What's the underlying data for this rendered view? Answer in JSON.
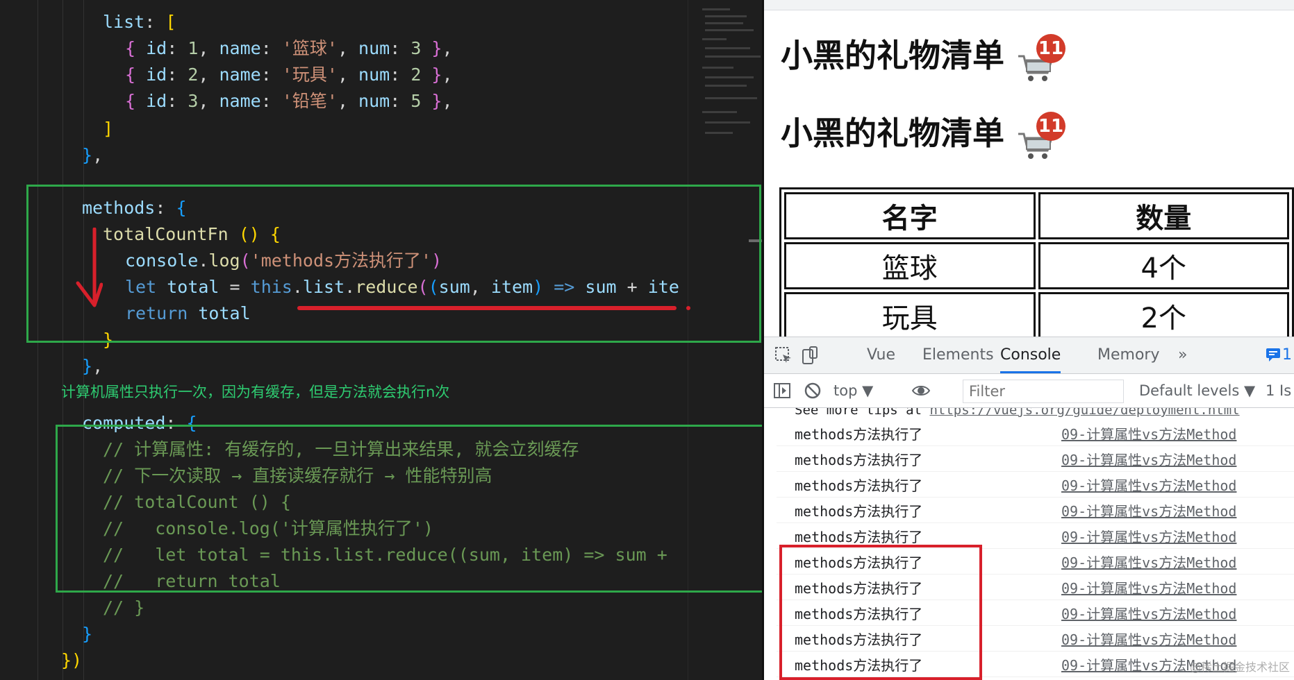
{
  "editor": {
    "lines": [
      [
        [
          "k",
          "list"
        ],
        [
          "p",
          ": "
        ],
        [
          "b1",
          "["
        ]
      ],
      [
        [
          "b2",
          "{ "
        ],
        [
          "k",
          "id"
        ],
        [
          "p",
          ": "
        ],
        [
          "n",
          "1"
        ],
        [
          "p",
          ", "
        ],
        [
          "k",
          "name"
        ],
        [
          "p",
          ": "
        ],
        [
          "s",
          "'篮球'"
        ],
        [
          "p",
          ", "
        ],
        [
          "k",
          "num"
        ],
        [
          "p",
          ": "
        ],
        [
          "n",
          "3"
        ],
        [
          "b2",
          " }"
        ],
        [
          "p",
          ","
        ]
      ],
      [
        [
          "b2",
          "{ "
        ],
        [
          "k",
          "id"
        ],
        [
          "p",
          ": "
        ],
        [
          "n",
          "2"
        ],
        [
          "p",
          ", "
        ],
        [
          "k",
          "name"
        ],
        [
          "p",
          ": "
        ],
        [
          "s",
          "'玩具'"
        ],
        [
          "p",
          ", "
        ],
        [
          "k",
          "num"
        ],
        [
          "p",
          ": "
        ],
        [
          "n",
          "2"
        ],
        [
          "b2",
          " }"
        ],
        [
          "p",
          ","
        ]
      ],
      [
        [
          "b2",
          "{ "
        ],
        [
          "k",
          "id"
        ],
        [
          "p",
          ": "
        ],
        [
          "n",
          "3"
        ],
        [
          "p",
          ", "
        ],
        [
          "k",
          "name"
        ],
        [
          "p",
          ": "
        ],
        [
          "s",
          "'铅笔'"
        ],
        [
          "p",
          ", "
        ],
        [
          "k",
          "num"
        ],
        [
          "p",
          ": "
        ],
        [
          "n",
          "5"
        ],
        [
          "b2",
          " }"
        ],
        [
          "p",
          ","
        ]
      ],
      [
        [
          "b1",
          "]"
        ]
      ],
      [
        [
          "b3",
          "}"
        ],
        [
          "p",
          ","
        ]
      ],
      [],
      [
        [
          "k",
          "methods"
        ],
        [
          "p",
          ": "
        ],
        [
          "b3",
          "{"
        ]
      ],
      [
        [
          "f",
          "totalCountFn"
        ],
        [
          "p",
          " "
        ],
        [
          "b1",
          "()"
        ],
        [
          "p",
          " "
        ],
        [
          "b1",
          "{"
        ]
      ],
      [
        [
          "k",
          "console"
        ],
        [
          "p",
          "."
        ],
        [
          "f",
          "log"
        ],
        [
          "b2",
          "("
        ],
        [
          "s",
          "'methods方法执行了'"
        ],
        [
          "b2",
          ")"
        ]
      ],
      [
        [
          "kw",
          "let"
        ],
        [
          "p",
          " "
        ],
        [
          "k",
          "total"
        ],
        [
          "p",
          " = "
        ],
        [
          "kw",
          "this"
        ],
        [
          "p",
          "."
        ],
        [
          "k",
          "list"
        ],
        [
          "p",
          "."
        ],
        [
          "f",
          "reduce"
        ],
        [
          "b2",
          "("
        ],
        [
          "b3",
          "("
        ],
        [
          "k",
          "sum"
        ],
        [
          "p",
          ", "
        ],
        [
          "k",
          "item"
        ],
        [
          "b3",
          ")"
        ],
        [
          "p",
          " "
        ],
        [
          "kw",
          "=>"
        ],
        [
          "p",
          " "
        ],
        [
          "k",
          "sum"
        ],
        [
          "p",
          " + "
        ],
        [
          "k",
          "ite"
        ]
      ],
      [
        [
          "kw",
          "return"
        ],
        [
          "p",
          " "
        ],
        [
          "k",
          "total"
        ]
      ],
      [
        [
          "b1",
          "}"
        ]
      ],
      [
        [
          "b3",
          "}"
        ],
        [
          "p",
          ","
        ]
      ],
      [],
      [
        [
          "k",
          "computed"
        ],
        [
          "p",
          ": "
        ],
        [
          "b3",
          "{"
        ]
      ],
      [
        [
          "c",
          "// 计算属性: 有缓存的, 一旦计算出来结果, 就会立刻缓存"
        ]
      ],
      [
        [
          "c",
          "// 下一次读取 → 直接读缓存就行 → 性能特别高"
        ]
      ],
      [
        [
          "c",
          "// totalCount () {"
        ]
      ],
      [
        [
          "c",
          "//   console.log('计算属性执行了')"
        ]
      ],
      [
        [
          "c",
          "//   let total = this.list.reduce((sum, item) => sum +"
        ]
      ],
      [
        [
          "c",
          "//   return total"
        ]
      ],
      [
        [
          "c",
          "// }"
        ]
      ],
      [
        [
          "b3",
          "}"
        ]
      ],
      [
        [
          "b1",
          "})"
        ]
      ]
    ],
    "annotation": "计算机属性只执行一次，因为有缓存，但是方法就会执行n次"
  },
  "browser": {
    "page_title": "小黑的礼物清单",
    "badge_count": "11",
    "table": {
      "headers": [
        "名字",
        "数量"
      ],
      "rows": [
        [
          "篮球",
          "4个"
        ],
        [
          "玩具",
          "2个"
        ]
      ]
    },
    "devtools": {
      "tabs": [
        "Vue",
        "Elements",
        "Console",
        "Memory",
        "»"
      ],
      "active_tab": "Console",
      "message_badge": "1",
      "context": "top",
      "filter_placeholder": "Filter",
      "levels": "Default levels ▼",
      "issues": "1 Is",
      "tips_prefix": "See more tips at ",
      "tips_link": "https://vuejs.org/guide/deployment.html",
      "log_message": "methods方法执行了",
      "log_source": "09-计算属性vs方法Method",
      "log_count": 10
    },
    "watermark": "@稀土掘金技术社区"
  },
  "colors": {
    "editor_bg": "#1e1e1e",
    "highlight_green": "#2ea84a",
    "annotation_red": "#d8202b",
    "badge_red": "#d23b2a",
    "devtools_active": "#1a73e8"
  },
  "icons": [
    "inspect-icon",
    "device-toggle-icon",
    "sidebar-icon",
    "clear-console-icon",
    "eye-icon",
    "cart-icon",
    "message-icon"
  ]
}
